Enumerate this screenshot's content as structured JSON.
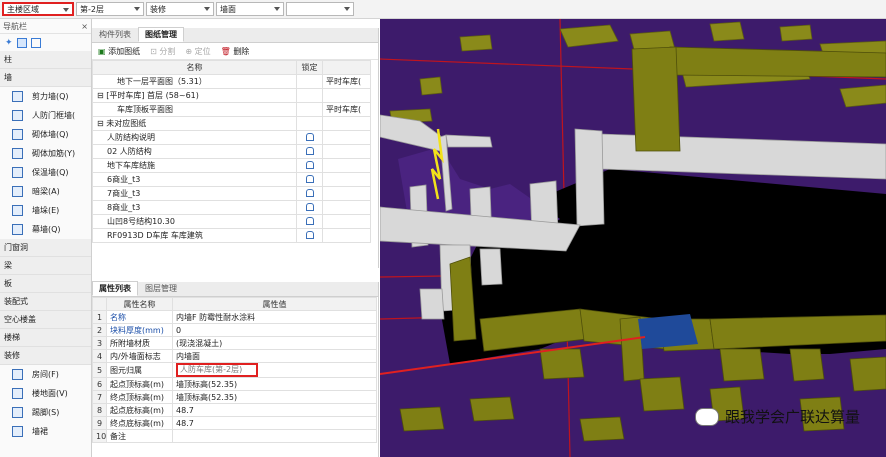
{
  "toolbar": {
    "combos": [
      {
        "value": "主楼区域",
        "highlighted": true
      },
      {
        "value": "第-2层",
        "highlighted": false
      },
      {
        "value": "装修",
        "highlighted": false
      },
      {
        "value": "墙面",
        "highlighted": false
      },
      {
        "value": "",
        "highlighted": false
      }
    ]
  },
  "nav": {
    "title": "导航栏",
    "close": "×",
    "categories_top": [
      "柱",
      "墙"
    ],
    "wall_items": [
      "剪力墙(Q)",
      "人防门框墙(",
      "砌体墙(Q)",
      "砌体加筋(Y)",
      "保温墙(Q)",
      "暗梁(A)",
      "墙垛(E)",
      "幕墙(Q)"
    ],
    "categories_mid": [
      "门窗洞",
      "梁",
      "板",
      "装配式",
      "空心楼盖",
      "楼梯",
      "装修"
    ],
    "decor_items": [
      "房间(F)",
      "楼地面(V)",
      "踢脚(S)",
      "墙裙"
    ]
  },
  "drawings": {
    "tabs": [
      "构件列表",
      "图纸管理"
    ],
    "active_tab": "图纸管理",
    "actions": [
      "添加图纸",
      "分割",
      "定位",
      "删除"
    ],
    "columns": [
      "名称",
      "锁定"
    ],
    "rows": [
      {
        "name": "地下一层平面图（5.31）",
        "locked": false,
        "extra": "平时车库(",
        "indent": 2
      },
      {
        "name": "[平时车库] 首层 (58~61)",
        "locked": false,
        "extra": "",
        "indent": 0,
        "group": true
      },
      {
        "name": "车库顶板平面图",
        "locked": false,
        "extra": "平时车库(",
        "indent": 2
      },
      {
        "name": "未对应图纸",
        "locked": false,
        "extra": "",
        "indent": 0,
        "group": true
      },
      {
        "name": "人防结构说明",
        "locked": true,
        "extra": "",
        "indent": 1
      },
      {
        "name": "02 人防结构",
        "locked": true,
        "extra": "",
        "indent": 1
      },
      {
        "name": "地下车库结施",
        "locked": true,
        "extra": "",
        "indent": 1
      },
      {
        "name": "6商业_t3",
        "locked": true,
        "extra": "",
        "indent": 1
      },
      {
        "name": "7商业_t3",
        "locked": true,
        "extra": "",
        "indent": 1
      },
      {
        "name": "8商业_t3",
        "locked": true,
        "extra": "",
        "indent": 1
      },
      {
        "name": "山凹8号结构10.30",
        "locked": true,
        "extra": "",
        "indent": 1
      },
      {
        "name": "RF0913D D车库 车库建筑",
        "locked": true,
        "extra": "",
        "indent": 1
      }
    ]
  },
  "properties": {
    "tabs": [
      "属性列表",
      "图层管理"
    ],
    "active_tab": "属性列表",
    "columns": [
      "属性名称",
      "属性值"
    ],
    "rows": [
      {
        "n": "1",
        "name": "名称",
        "value": "内墙F 防霉性耐水涂料",
        "blue": true
      },
      {
        "n": "2",
        "name": "块料厚度(mm)",
        "value": "0",
        "blue": true
      },
      {
        "n": "3",
        "name": "所附墙材质",
        "value": "(现浇混凝土)",
        "blue": false
      },
      {
        "n": "4",
        "name": "内/外墙面标志",
        "value": "内墙面",
        "blue": false
      },
      {
        "n": "5",
        "name": "图元归属",
        "value": "人防车库(第-2层)",
        "blue": false,
        "highlighted": true
      },
      {
        "n": "6",
        "name": "起点顶标高(m)",
        "value": "墙顶标高(52.35)",
        "blue": false
      },
      {
        "n": "7",
        "name": "终点顶标高(m)",
        "value": "墙顶标高(52.35)",
        "blue": false
      },
      {
        "n": "8",
        "name": "起点底标高(m)",
        "value": "48.7",
        "blue": false
      },
      {
        "n": "9",
        "name": "终点底标高(m)",
        "value": "48.7",
        "blue": false
      },
      {
        "n": "10",
        "name": "备注",
        "value": "",
        "blue": false
      }
    ]
  },
  "viewport": {
    "watermark": "跟我学会广联达算量",
    "colors": {
      "background": "#3d1b6b",
      "slab": "#000000",
      "wall": "#d8d8d8",
      "finish": "#8a8a1a",
      "red_line": "#c0141e",
      "selected": "#1f4a9a"
    }
  }
}
